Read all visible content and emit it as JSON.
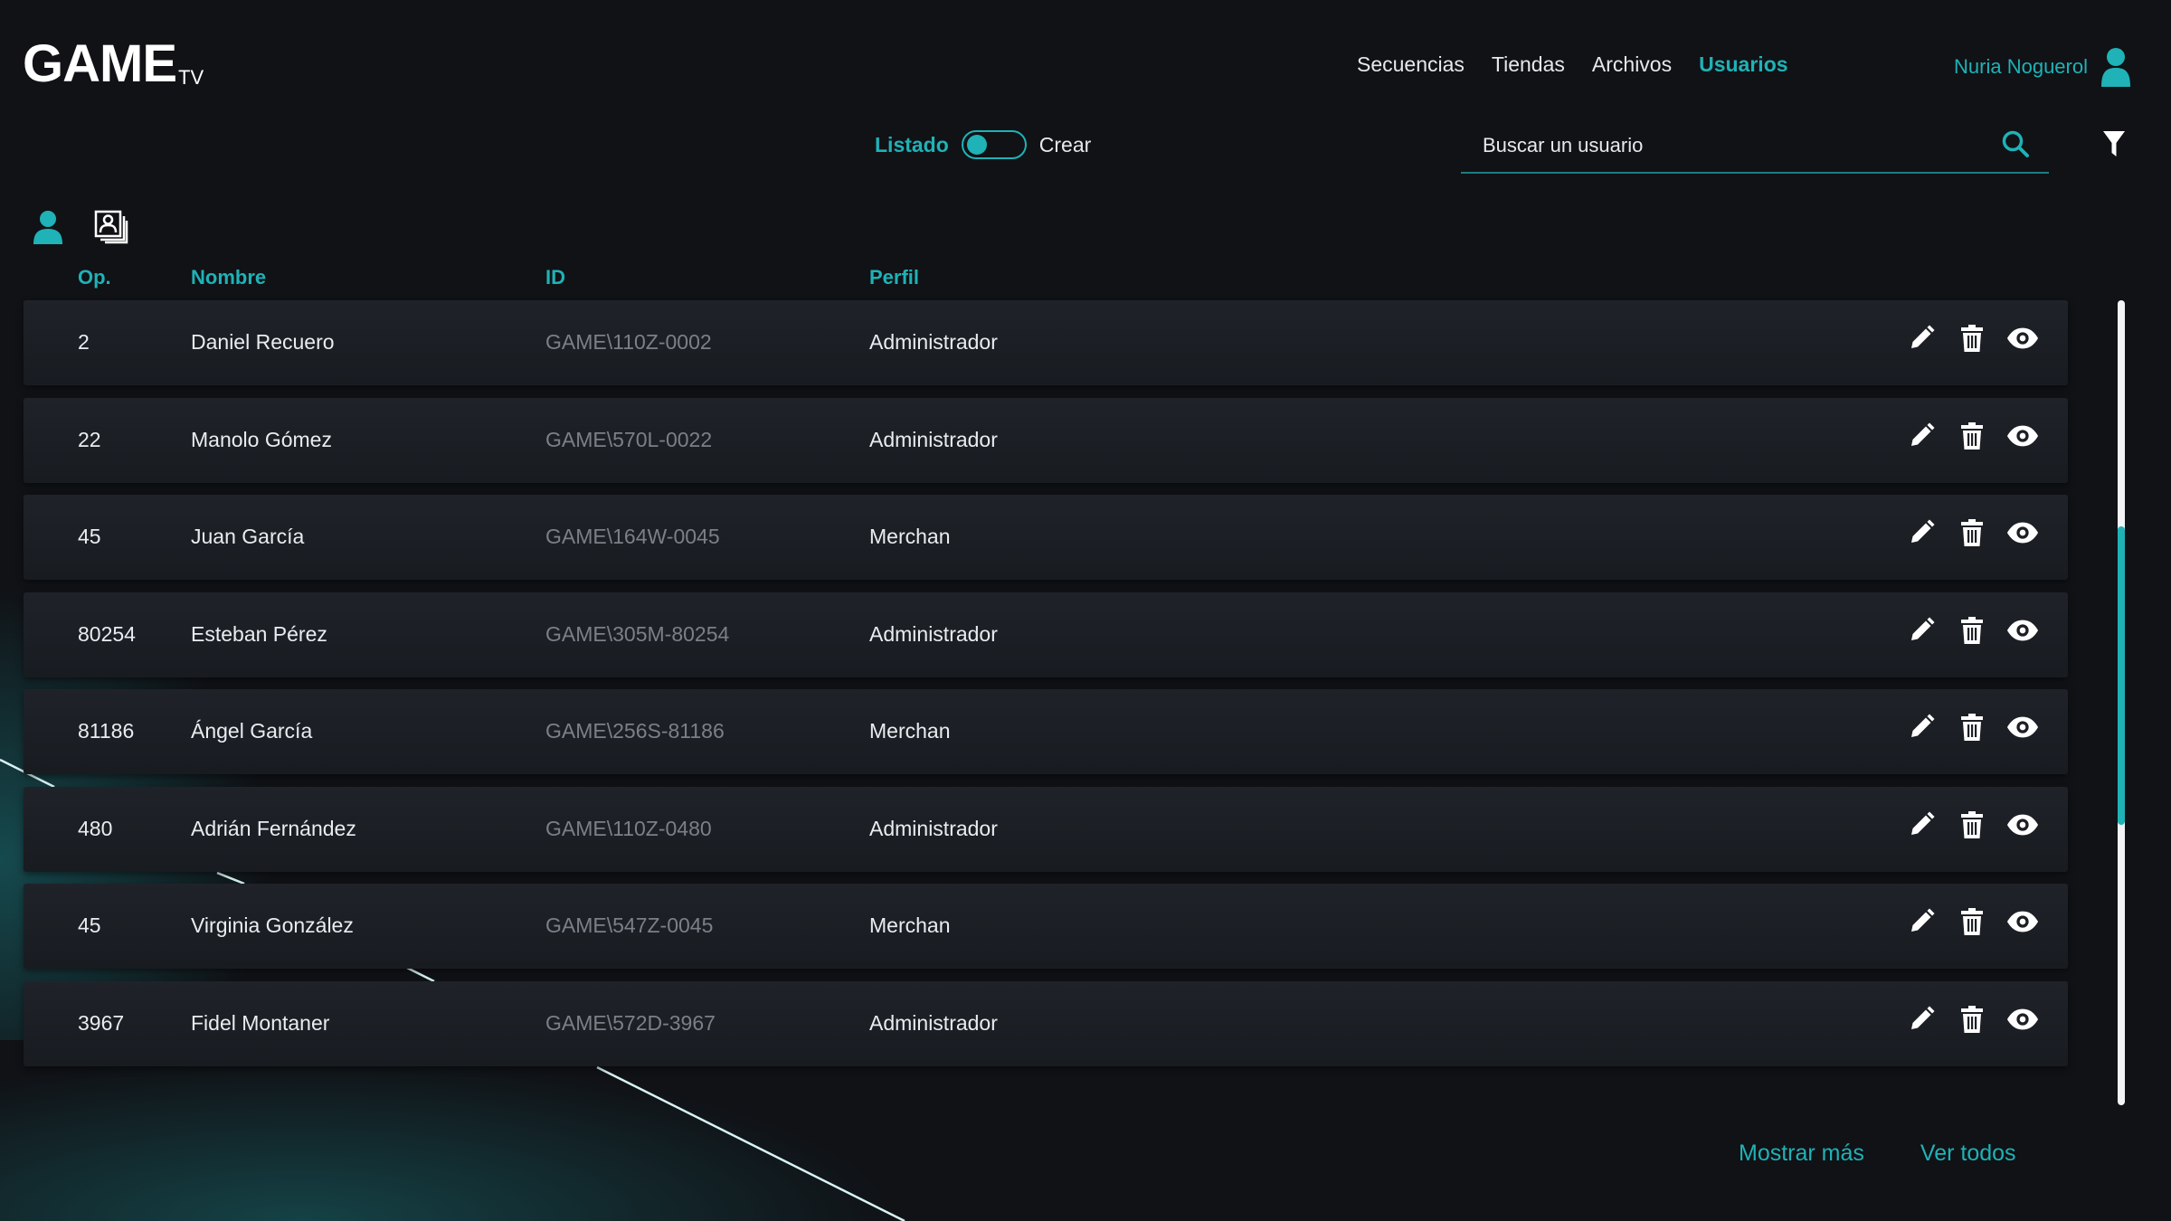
{
  "app": {
    "logo_main": "GAME",
    "logo_sub": "TV"
  },
  "nav": {
    "items": [
      "Secuencias",
      "Tiendas",
      "Archivos",
      "Usuarios"
    ],
    "active": "Usuarios"
  },
  "user": {
    "name": "Nuria Noguerol",
    "icon": "user-avatar-icon"
  },
  "view_toggle": {
    "left_label": "Listado",
    "right_label": "Crear",
    "selected": "Listado"
  },
  "search": {
    "placeholder": "Buscar un usuario",
    "icon": "search-icon"
  },
  "filter": {
    "icon": "filter-icon"
  },
  "view_modes": {
    "icons": [
      "person-view-icon",
      "contact-cards-icon"
    ]
  },
  "table": {
    "columns": [
      "Op.",
      "Nombre",
      "ID",
      "Perfil"
    ],
    "rows": [
      {
        "op": "2",
        "name": "Daniel Recuero",
        "id": "GAME\\110Z-0002",
        "perfil": "Administrador"
      },
      {
        "op": "22",
        "name": "Manolo Gómez",
        "id": "GAME\\570L-0022",
        "perfil": "Administrador"
      },
      {
        "op": "45",
        "name": "Juan García",
        "id": "GAME\\164W-0045",
        "perfil": "Merchan"
      },
      {
        "op": "80254",
        "name": "Esteban Pérez",
        "id": "GAME\\305M-80254",
        "perfil": "Administrador"
      },
      {
        "op": "81186",
        "name": "Ángel García",
        "id": "GAME\\256S-81186",
        "perfil": "Merchan"
      },
      {
        "op": "480",
        "name": "Adrián Fernández",
        "id": "GAME\\110Z-0480",
        "perfil": "Administrador"
      },
      {
        "op": "45",
        "name": "Virginia González",
        "id": "GAME\\547Z-0045",
        "perfil": "Merchan"
      },
      {
        "op": "3967",
        "name": "Fidel Montaner",
        "id": "GAME\\572D-3967",
        "perfil": "Administrador"
      }
    ],
    "row_actions": [
      "edit-icon",
      "delete-icon",
      "view-icon"
    ]
  },
  "footer": {
    "show_more": "Mostrar más",
    "view_all": "Ver todos"
  },
  "colors": {
    "accent": "#1fb2b6",
    "background": "#101216",
    "row": "#1d2026",
    "muted_text": "#7b8087"
  }
}
